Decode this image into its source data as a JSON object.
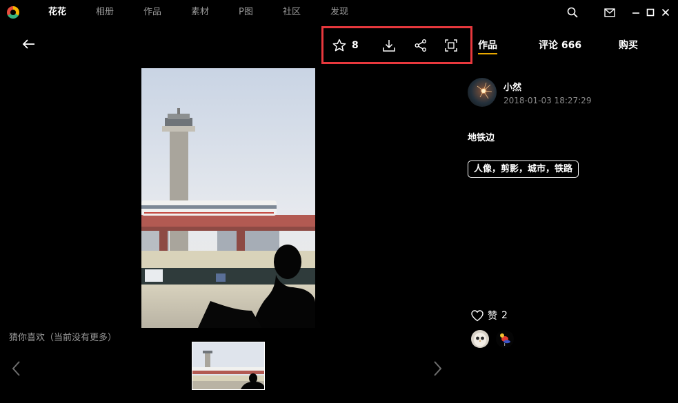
{
  "app": {
    "nav": [
      {
        "label": "花花"
      },
      {
        "label": "相册"
      },
      {
        "label": "作品"
      },
      {
        "label": "素材"
      },
      {
        "label": "P图"
      },
      {
        "label": "社区"
      },
      {
        "label": "发现"
      }
    ]
  },
  "toolbar": {
    "favorite_count": "8"
  },
  "tabs": {
    "works": "作品",
    "comments": "评论 666",
    "buy": "购买"
  },
  "author": {
    "name": "小然",
    "time": "2018-01-03 18:27:29"
  },
  "post": {
    "title": "地铁边",
    "tags": "人像，剪影，城市，铁路"
  },
  "likes": {
    "label": "赞",
    "count": "2"
  },
  "recommend": {
    "label": "猜你喜欢（当前没有更多）"
  },
  "colors": {
    "highlight_border": "#e8383d",
    "tab_underline": "#e9a800",
    "background": "#000000"
  }
}
